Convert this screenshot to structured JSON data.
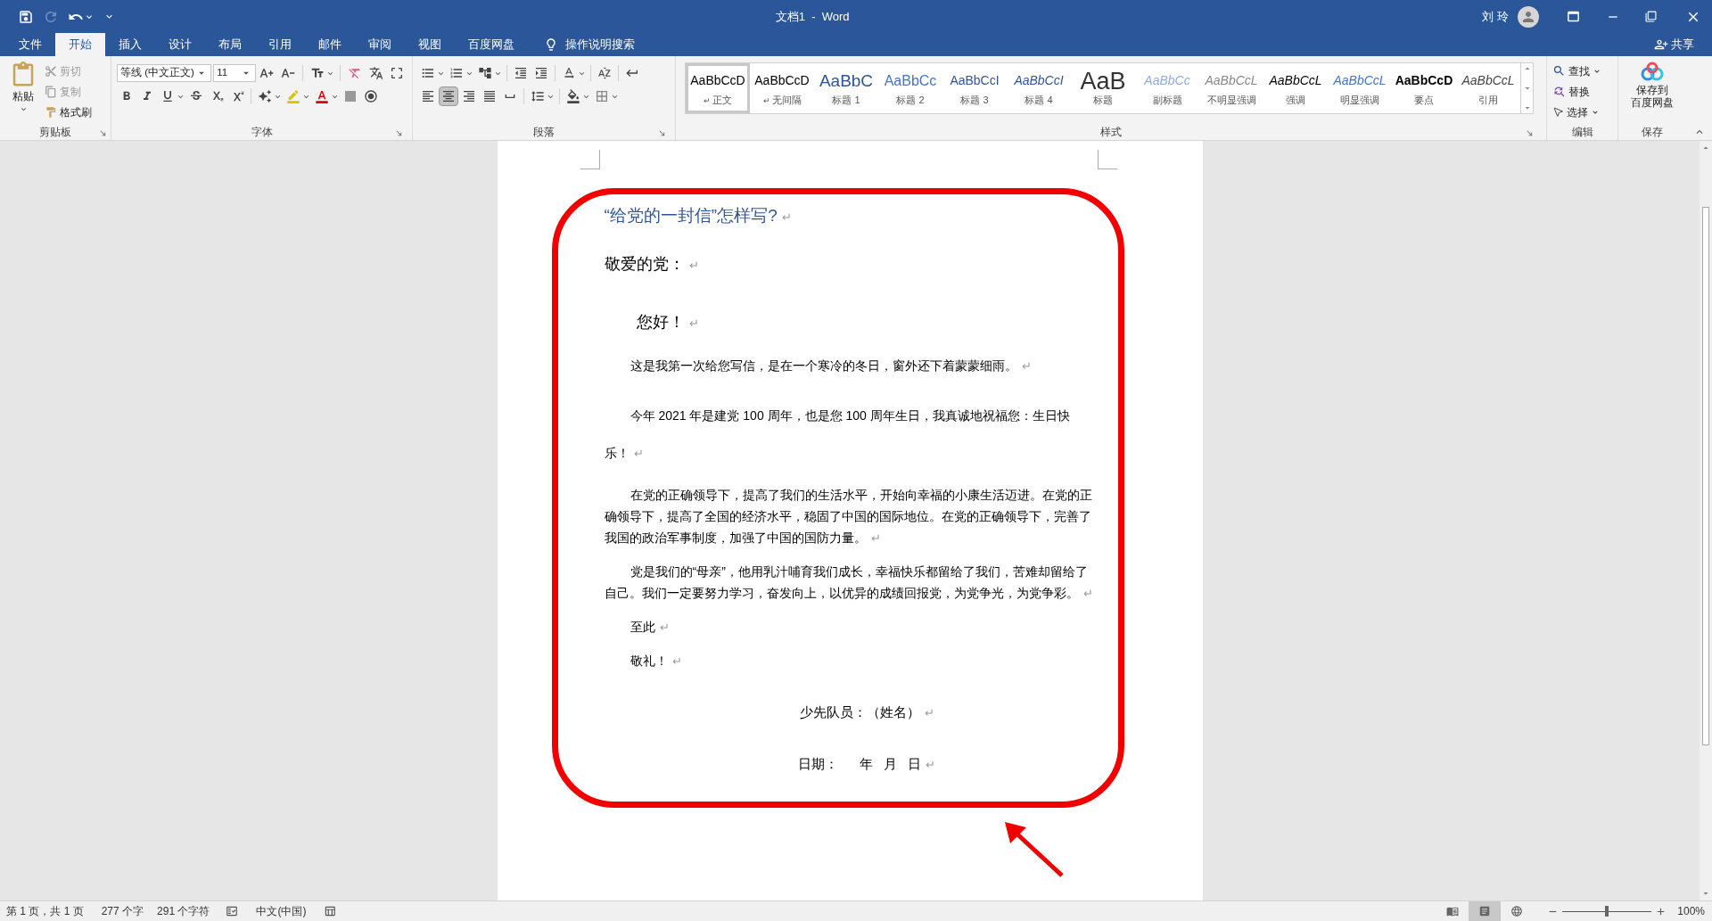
{
  "title_bar": {
    "title": "文档1  -  Word",
    "user": "刘 玲",
    "redo": {
      "disabled": true
    }
  },
  "tabs": [
    {
      "label": "文件",
      "selected": false
    },
    {
      "label": "开始",
      "selected": true
    },
    {
      "label": "插入",
      "selected": false
    },
    {
      "label": "设计",
      "selected": false
    },
    {
      "label": "布局",
      "selected": false
    },
    {
      "label": "引用",
      "selected": false
    },
    {
      "label": "邮件",
      "selected": false
    },
    {
      "label": "审阅",
      "selected": false
    },
    {
      "label": "视图",
      "selected": false
    },
    {
      "label": "百度网盘",
      "selected": false
    }
  ],
  "tell_me": "操作说明搜索",
  "share": "共享",
  "ribbon": {
    "clipboard": {
      "paste": "粘贴",
      "cut": "剪切",
      "copy": "复制",
      "format_painter": "格式刷",
      "label": "剪贴板"
    },
    "font": {
      "name": "等线 (中文正文)",
      "size": "11",
      "label": "字体"
    },
    "paragraph": {
      "alignment": [
        {
          "kind": "left",
          "selected": false
        },
        {
          "kind": "center",
          "selected": true
        },
        {
          "kind": "right",
          "selected": false
        },
        {
          "kind": "justify",
          "selected": false
        },
        {
          "kind": "distributed",
          "selected": false
        }
      ],
      "label": "段落"
    },
    "styles": {
      "items": [
        {
          "preview": "AaBbCcD",
          "name": "正文",
          "mark": "↵",
          "kind": "normal",
          "selected": true
        },
        {
          "preview": "AaBbCcD",
          "name": "无间隔",
          "mark": "↵",
          "kind": "no_spacing",
          "selected": false
        },
        {
          "preview": "AaBbC",
          "name": "标题 1",
          "kind": "heading1",
          "selected": false
        },
        {
          "preview": "AaBbCc",
          "name": "标题 2",
          "kind": "heading2",
          "selected": false
        },
        {
          "preview": "AaBbCcI",
          "name": "标题 3",
          "kind": "heading3",
          "selected": false
        },
        {
          "preview": "AaBbCcI",
          "name": "标题 4",
          "kind": "heading4",
          "selected": false
        },
        {
          "preview": "AaB",
          "name": "标题",
          "kind": "title",
          "selected": false
        },
        {
          "preview": "AaBbCc",
          "name": "副标题",
          "kind": "subtitle",
          "selected": false
        },
        {
          "preview": "AaBbCcL",
          "name": "不明显强调",
          "kind": "subtle_emphasis",
          "selected": false
        },
        {
          "preview": "AaBbCcL",
          "name": "强调",
          "kind": "emphasis",
          "selected": false
        },
        {
          "preview": "AaBbCcL",
          "name": "明显强调",
          "kind": "intense_emphasis",
          "selected": false
        },
        {
          "preview": "AaBbCcD",
          "name": "要点",
          "kind": "strong",
          "selected": false
        },
        {
          "preview": "AaBbCcL",
          "name": "引用",
          "kind": "quote",
          "selected": false
        }
      ],
      "label": "样式"
    },
    "editing": {
      "find": "查找",
      "replace": "替换",
      "select": "选择",
      "label": "编辑"
    },
    "save": {
      "button": [
        "保存到",
        "百度网盘"
      ],
      "label": "保存"
    }
  },
  "document": {
    "paragraphs": [
      {
        "kind": "title",
        "text": "“给党的一封信”怎样写?",
        "mark": "↵"
      },
      {
        "kind": "salutation",
        "text": "敬爱的党：",
        "mark": "↵"
      },
      {
        "kind": "greeting",
        "text": "您好！",
        "mark": "↵"
      },
      {
        "kind": "body_loose",
        "text": "这是我第一次给您写信，是在一个寒冷的冬日，窗外还下着蒙蒙细雨。",
        "mark": "↵"
      },
      {
        "kind": "body_loose",
        "text": "今年 2021 年是建党 100 周年，也是您 100 周年生日，我真诚地祝福您：生日快乐！",
        "mark": "↵"
      },
      {
        "kind": "body",
        "text": "在党的正确领导下，提高了我们的生活水平，开始向幸福的小康生活迈进。在党的正确领导下，提高了全国的经济水平，稳固了中国的国际地位。在党的正确领导下，完善了我国的政治军事制度，加强了中国的国防力量。",
        "mark": "↵"
      },
      {
        "kind": "body",
        "text": "党是我们的“母亲”，他用乳汁哺育我们成长，幸福快乐都留给了我们，苦难却留给了自己。我们一定要努力学习，奋发向上，以优异的成绩回报党，为党争光，为党争彩。",
        "mark": "↵"
      },
      {
        "kind": "body",
        "text": "至此",
        "mark": "↵"
      },
      {
        "kind": "body",
        "text": "敬礼！",
        "mark": "↵"
      },
      {
        "kind": "signature",
        "text": "少先队员：（姓名）",
        "mark": "↵"
      },
      {
        "kind": "signature",
        "text": "日期：      年   月   日",
        "mark": "↵"
      }
    ]
  },
  "status_bar": {
    "page": "第 1 页，共 1 页",
    "words": "277 个字",
    "chars": "291 个字符",
    "language": "中文(中国)",
    "views": [
      {
        "kind": "read",
        "selected": false
      },
      {
        "kind": "print",
        "selected": true
      },
      {
        "kind": "web",
        "selected": false
      }
    ],
    "zoom": {
      "level": 0.5,
      "reading": "100%"
    }
  }
}
